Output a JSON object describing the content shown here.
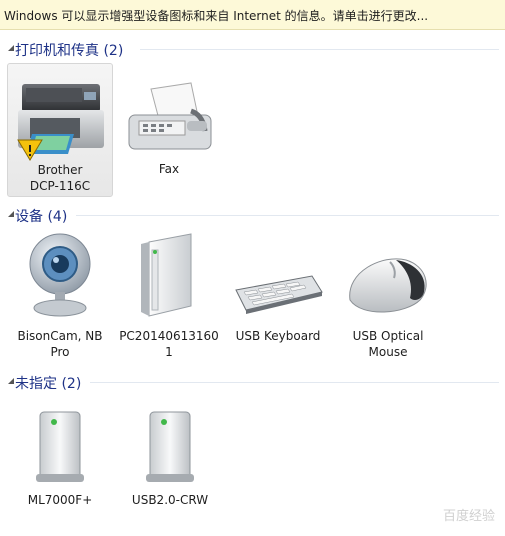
{
  "infobar": {
    "text": "Windows 可以显示增强型设备图标和来自 Internet 的信息。请单击进行更改..."
  },
  "groups": [
    {
      "title": "打印机和传真 (2)",
      "items": [
        {
          "line1": "Brother",
          "line2": "DCP-116C"
        },
        {
          "line1": "Fax",
          "line2": ""
        }
      ]
    },
    {
      "title": "设备 (4)",
      "items": [
        {
          "line1": "BisonCam, NB",
          "line2": "Pro"
        },
        {
          "line1": "PC20140613160",
          "line2": "1"
        },
        {
          "line1": "USB Keyboard",
          "line2": ""
        },
        {
          "line1": "USB Optical",
          "line2": "Mouse"
        }
      ]
    },
    {
      "title": "未指定 (2)",
      "items": [
        {
          "line1": "ML7000F+",
          "line2": ""
        },
        {
          "line1": "USB2.0-CRW",
          "line2": ""
        }
      ]
    }
  ],
  "watermark": {
    "text": "百度经验"
  },
  "colors": {
    "group_title": "#1e3287",
    "infobar_bg": "#fdf9d8",
    "selected_bg": "#ececec"
  }
}
